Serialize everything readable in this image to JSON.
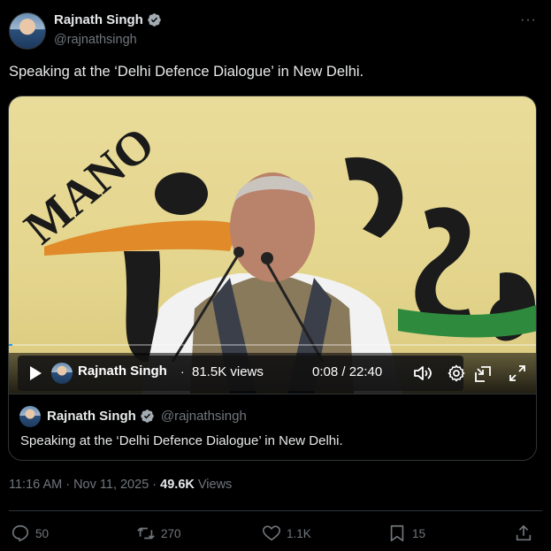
{
  "author": {
    "name": "Rajnath Singh",
    "handle": "@rajnathsingh",
    "verified": true
  },
  "more_label": "···",
  "tweet": {
    "text": "Speaking at the ‘Delhi Defence Dialogue’ in New Delhi."
  },
  "video": {
    "banner_text": "MANO",
    "channel_name": "Rajnath Singh",
    "separator": "·",
    "views": "81.5K views",
    "time": "0:08 / 22:40",
    "progress_fraction": 0.006
  },
  "quote": {
    "name": "Rajnath Singh",
    "handle": "@rajnathsingh",
    "text": "Speaking at the ‘Delhi Defence Dialogue’ in New Delhi."
  },
  "meta": {
    "timestamp": "11:16 AM · Nov 11, 2025 ·",
    "views_count": "49.6K",
    "views_label": "Views"
  },
  "actions": {
    "replies": "50",
    "reposts": "270",
    "likes": "1.1K",
    "bookmarks": "15"
  },
  "colors": {
    "accent": "#1d9bf0",
    "muted": "#71767b",
    "text": "#e7e9ea",
    "background": "#000000"
  }
}
